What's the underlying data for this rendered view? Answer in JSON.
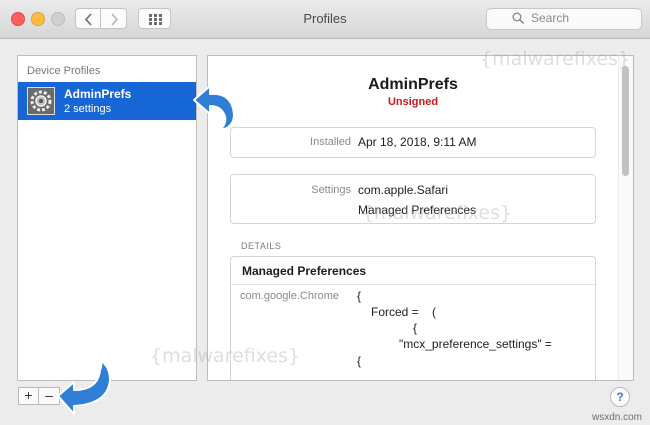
{
  "window": {
    "title": "Profiles",
    "search_placeholder": "Search"
  },
  "sidebar": {
    "header": "Device Profiles",
    "items": [
      {
        "name": "AdminPrefs",
        "subtitle": "2 settings",
        "icon": "gear-icon",
        "selected": true
      }
    ]
  },
  "detail": {
    "title": "AdminPrefs",
    "status": "Unsigned",
    "installed_label": "Installed",
    "installed_value": "Apr 18, 2018, 9:11 AM",
    "settings_label": "Settings",
    "settings_values": [
      "com.apple.Safari",
      "Managed Preferences"
    ],
    "details_header": "DETAILS",
    "details_title": "Managed Preferences",
    "details_key": "com.google.Chrome",
    "code_lines": [
      "{",
      "Forced =    (",
      "{",
      "\"mcx_preference_settings\" =",
      "{"
    ]
  },
  "bottom": {
    "add_label": "+",
    "remove_label": "–",
    "help_label": "?"
  },
  "watermark": "{malwarefixes}",
  "credit": "wsxdn.com",
  "colors": {
    "selection": "#1666d5",
    "unsigned": "#c8161d",
    "arrow": "#2f7fd6"
  }
}
